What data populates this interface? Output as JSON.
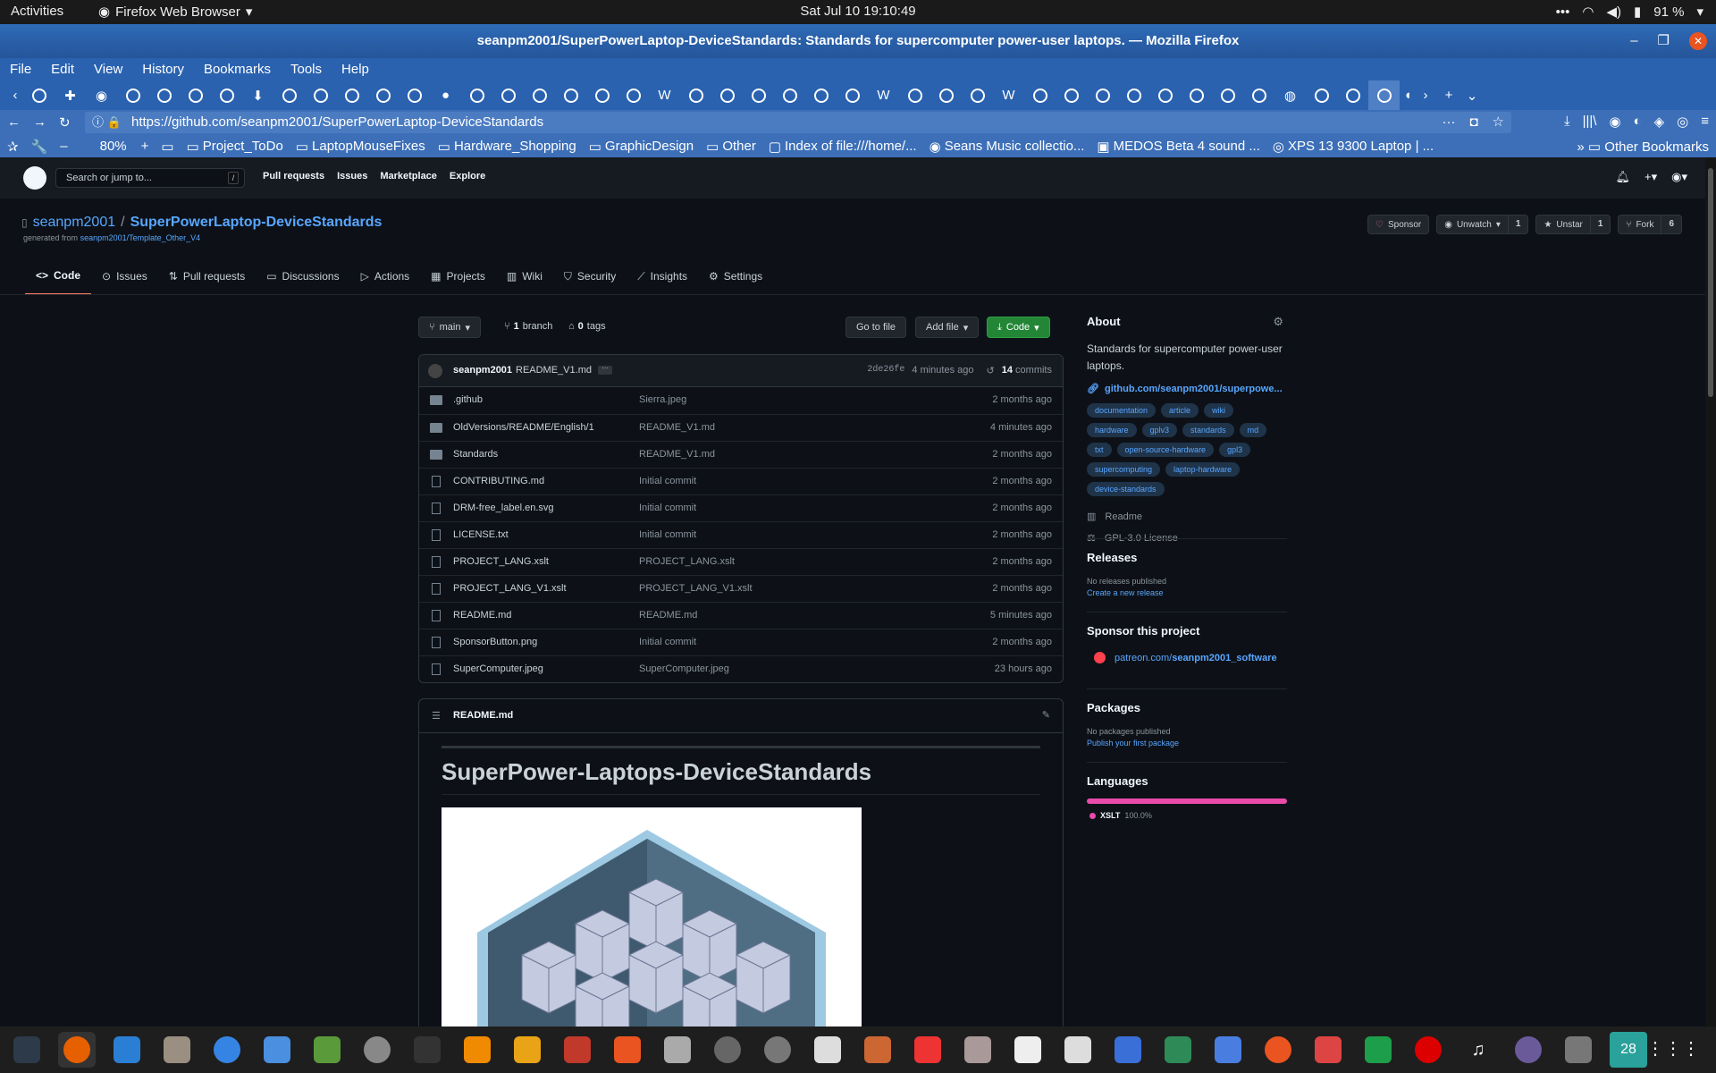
{
  "system": {
    "activities": "Activities",
    "app_menu": "Firefox Web Browser",
    "clock": "Sat Jul 10  19:10:49",
    "battery": "91 %"
  },
  "window": {
    "title": "seanpm2001/SuperPowerLaptop-DeviceStandards: Standards for supercomputer power-user laptops. — Mozilla Firefox"
  },
  "menu": [
    "File",
    "Edit",
    "View",
    "History",
    "Bookmarks",
    "Tools",
    "Help"
  ],
  "address": {
    "url": "https://github.com/seanpm2001/SuperPowerLaptop-DeviceStandards",
    "more": "···"
  },
  "bookmarks": {
    "zoom": "80%",
    "items": [
      "Project_ToDo",
      "LaptopMouseFixes",
      "Hardware_Shopping",
      "GraphicDesign",
      "Other",
      "Index of file:///home/...",
      "Seans Music collectio...",
      "MEDOS Beta 4 sound ...",
      "XPS 13 9300 Laptop | ..."
    ],
    "other": "Other Bookmarks"
  },
  "github": {
    "search_placeholder": "Search or jump to...",
    "search_key": "/",
    "nav": [
      "Pull requests",
      "Issues",
      "Marketplace",
      "Explore"
    ],
    "owner": "seanpm2001",
    "repo": "SuperPowerLaptop-DeviceStandards",
    "generated_from_label": "generated from",
    "generated_from": "seanpm2001/Template_Other_V4",
    "actions": {
      "sponsor": "Sponsor",
      "watch": "Unwatch",
      "watch_count": "1",
      "star": "Unstar",
      "star_count": "1",
      "fork": "Fork",
      "fork_count": "6"
    },
    "tabs": [
      "Code",
      "Issues",
      "Pull requests",
      "Discussions",
      "Actions",
      "Projects",
      "Wiki",
      "Security",
      "Insights",
      "Settings"
    ],
    "branch": "main",
    "branch_count": "1",
    "branch_label": "branch",
    "tag_count": "0",
    "tag_label": "tags",
    "goto_file": "Go to file",
    "add_file": "Add file",
    "code_btn": "Code",
    "last_commit": {
      "author": "seanpm2001",
      "message": "README_V1.md",
      "sha": "2de26fe",
      "age": "4 minutes ago",
      "commits_count": "14",
      "commits_label": "commits"
    },
    "files": [
      {
        "type": "dir",
        "name": ".github",
        "message": "Sierra.jpeg",
        "age": "2 months ago"
      },
      {
        "type": "dir",
        "name": "OldVersions/README/English/1",
        "message": "README_V1.md",
        "age": "4 minutes ago"
      },
      {
        "type": "dir",
        "name": "Standards",
        "message": "README_V1.md",
        "age": "2 months ago"
      },
      {
        "type": "file",
        "name": "CONTRIBUTING.md",
        "message": "Initial commit",
        "age": "2 months ago"
      },
      {
        "type": "file",
        "name": "DRM-free_label.en.svg",
        "message": "Initial commit",
        "age": "2 months ago"
      },
      {
        "type": "file",
        "name": "LICENSE.txt",
        "message": "Initial commit",
        "age": "2 months ago"
      },
      {
        "type": "file",
        "name": "PROJECT_LANG.xslt",
        "message": "PROJECT_LANG.xslt",
        "age": "2 months ago"
      },
      {
        "type": "file",
        "name": "PROJECT_LANG_V1.xslt",
        "message": "PROJECT_LANG_V1.xslt",
        "age": "2 months ago"
      },
      {
        "type": "file",
        "name": "README.md",
        "message": "README.md",
        "age": "5 minutes ago"
      },
      {
        "type": "file",
        "name": "SponsorButton.png",
        "message": "Initial commit",
        "age": "2 months ago"
      },
      {
        "type": "file",
        "name": "SuperComputer.jpeg",
        "message": "SuperComputer.jpeg",
        "age": "23 hours ago"
      }
    ],
    "readme": {
      "filename": "README.md",
      "heading": "SuperPower-Laptops-DeviceStandards"
    },
    "about": {
      "title": "About",
      "description": "Standards for supercomputer power-user laptops.",
      "website": "github.com/seanpm2001/superpowe...",
      "topics": [
        "documentation",
        "article",
        "wiki",
        "hardware",
        "gplv3",
        "standards",
        "md",
        "txt",
        "open-source-hardware",
        "gpl3",
        "supercomputing",
        "laptop-hardware",
        "device-standards"
      ],
      "readme": "Readme",
      "license": "GPL-3.0 License"
    },
    "releases": {
      "title": "Releases",
      "none": "No releases published",
      "create": "Create a new release"
    },
    "sponsor": {
      "title": "Sponsor this project",
      "link_prefix": "patreon.com/",
      "link_user": "seanpm2001_software"
    },
    "packages": {
      "title": "Packages",
      "none": "No packages published",
      "publish": "Publish your first package"
    },
    "languages": {
      "title": "Languages",
      "name": "XSLT",
      "percent": "100.0%",
      "color": "#ea4aaa"
    }
  },
  "dock_badge": "28"
}
